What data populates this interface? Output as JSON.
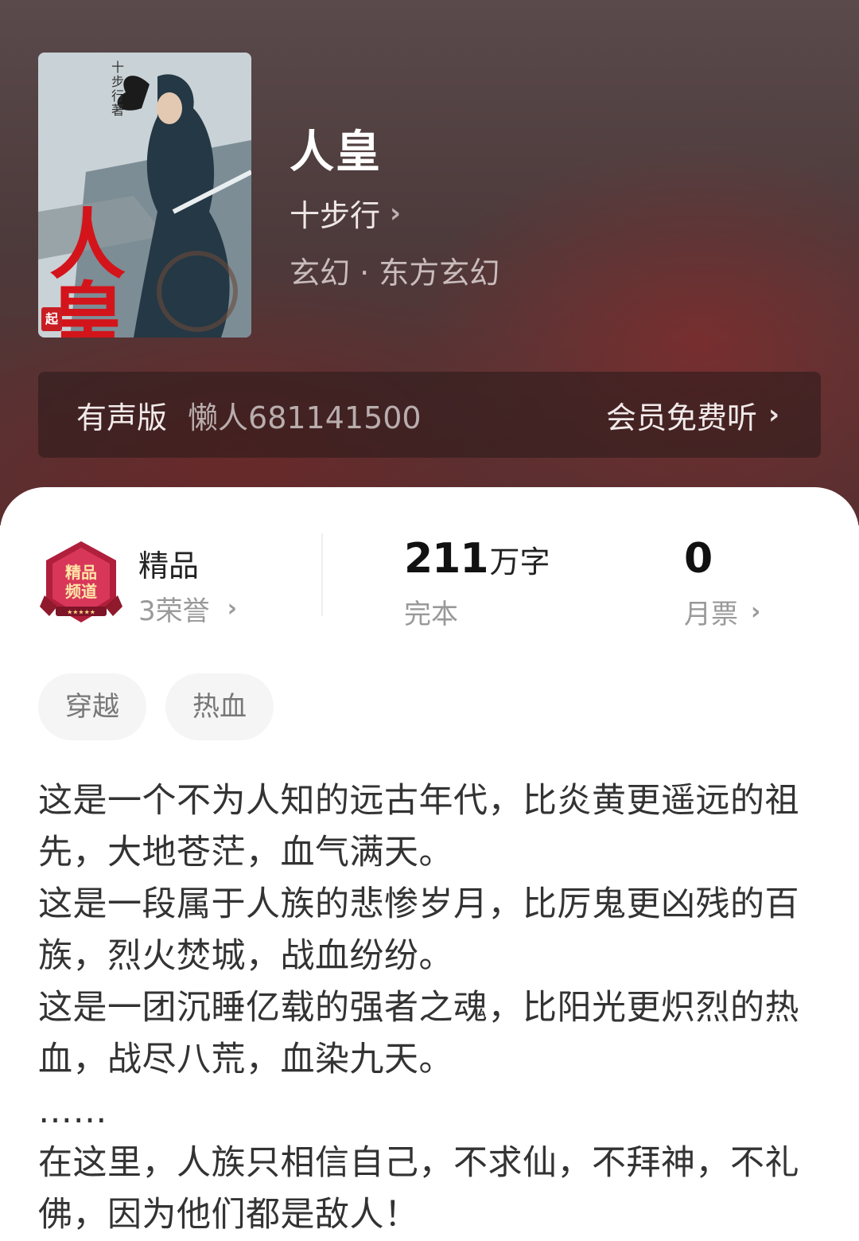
{
  "book": {
    "title": "人皇",
    "author": "十步行",
    "category": "玄幻 · 东方玄幻",
    "cover": {
      "author_text": "十步行著",
      "title_text": "人皇",
      "badge_text": "起"
    }
  },
  "audio": {
    "label": "有声版",
    "narrator": "懒人681141500",
    "action": "会员免费听"
  },
  "stats": {
    "honor": {
      "title": "精品",
      "subtitle": "3荣誉",
      "badge_text": "精品频道"
    },
    "words": {
      "value": "211",
      "unit": "万字",
      "status": "完本"
    },
    "monthly_ticket": {
      "value": "0",
      "label": "月票"
    }
  },
  "tags": [
    "穿越",
    "热血"
  ],
  "synopsis": [
    "这是一个不为人知的远古年代，比炎黄更遥远的祖先，大地苍茫，血气满天。",
    "这是一段属于人族的悲惨岁月，比厉鬼更凶残的百族，烈火焚城，战血纷纷。",
    "这是一团沉睡亿载的强者之魂，比阳光更炽烈的热血，战尽八荒，血染九天。",
    "……",
    "在这里，人族只相信自己，不求仙，不拜神，不礼佛，因为他们都是敌人！"
  ],
  "colors": {
    "hero_bg": "#4d3a3b",
    "cover_title_red": "#d3141b",
    "text_dark": "#222222",
    "text_muted": "#999999",
    "tag_bg": "#f5f5f5"
  }
}
